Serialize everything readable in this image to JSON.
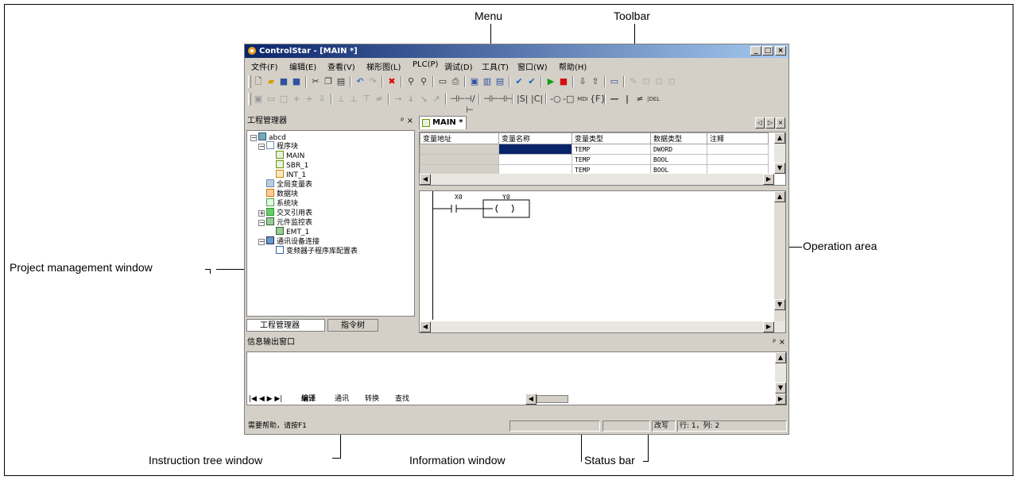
{
  "callouts": {
    "menu": "Menu",
    "toolbar": "Toolbar",
    "project_window": "Project management window",
    "operation_area": "Operation area",
    "instruction_tree": "Instruction tree window",
    "information_window": "Information window",
    "status_bar": "Status bar"
  },
  "window": {
    "title": "ControlStar - [MAIN *]",
    "menu": [
      "文件(F)",
      "编辑(E)",
      "查看(V)",
      "梯形图(L)",
      "PLC(P)",
      "调试(D)",
      "工具(T)",
      "窗口(W)",
      "帮助(H)"
    ]
  },
  "project_pane": {
    "title": "工程管理器",
    "pin": "ᵖ ×",
    "tree": {
      "root": "abcd",
      "program_blocks": "程序块",
      "main": "MAIN",
      "sbr": "SBR_1",
      "int": "INT_1",
      "global_vars": "全局变量表",
      "data_block": "数据块",
      "system_block": "系统块",
      "cross_ref": "交叉引用表",
      "monitor_table": "元件监控表",
      "emt": "EMT_1",
      "comm": "通讯设备连接",
      "inverter": "变频器子程序库配置表"
    },
    "tabs": [
      "工程管理器",
      "指令树"
    ]
  },
  "editor": {
    "tab": "MAIN *",
    "grid_headers": [
      "变量地址",
      "变量名称",
      "变量类型",
      "数据类型",
      "注释"
    ],
    "grid_rows": [
      [
        "",
        "",
        "TEMP",
        "DWORD",
        ""
      ],
      [
        "",
        "",
        "TEMP",
        "BOOL",
        ""
      ],
      [
        "",
        "",
        "TEMP",
        "BOOL",
        ""
      ]
    ],
    "ladder": {
      "contact": "X0",
      "coil": "Y0"
    }
  },
  "output_pane": {
    "title": "信息输出窗口",
    "tabs": [
      "编译",
      "通讯",
      "转换",
      "查找"
    ]
  },
  "statusbar": {
    "help": "需要帮助，请按F1",
    "mode": "改写",
    "pos": "行:  1，列:  2"
  }
}
